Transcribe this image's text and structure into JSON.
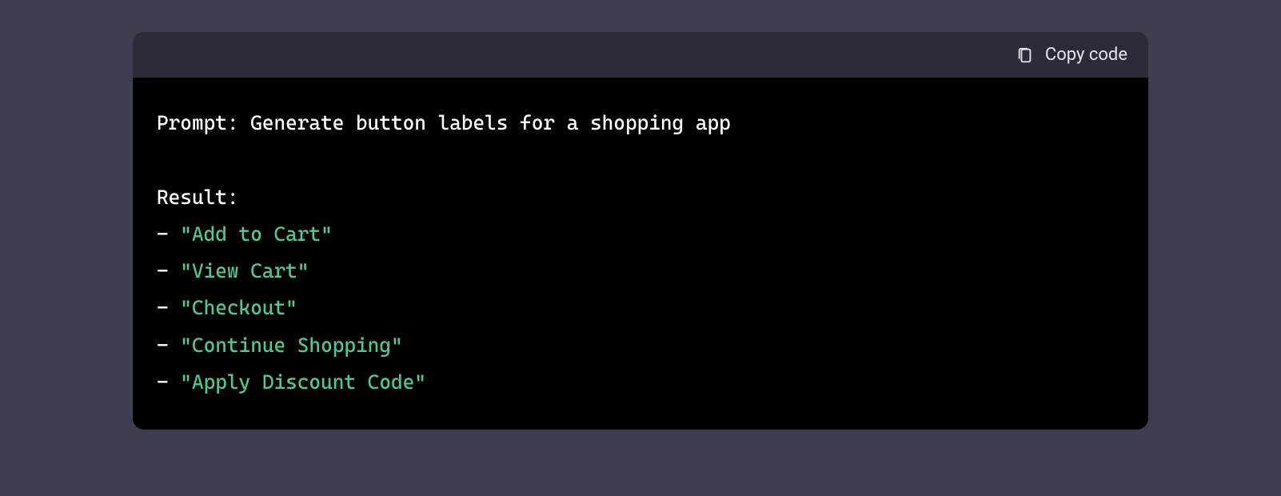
{
  "header": {
    "copy_label": "Copy code"
  },
  "code": {
    "prompt_line": "Prompt: Generate button labels for a shopping app",
    "result_label": "Result:",
    "items": [
      "\"Add to Cart\"",
      "\"View Cart\"",
      "\"Checkout\"",
      "\"Continue Shopping\"",
      "\"Apply Discount Code\""
    ],
    "bullet": "- "
  }
}
